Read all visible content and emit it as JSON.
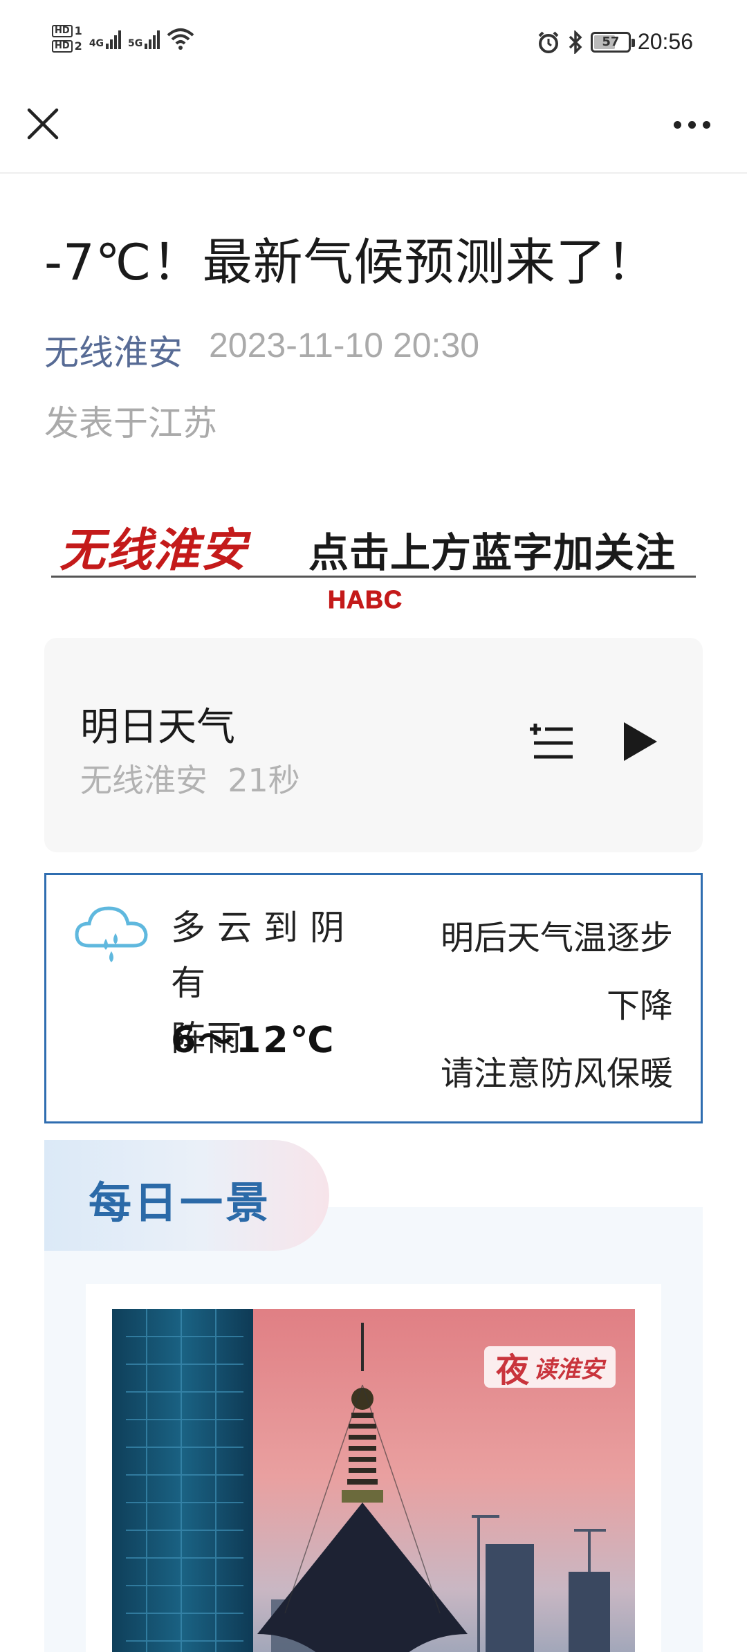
{
  "status_bar": {
    "hd1": "HD",
    "hd1_sub": "1",
    "hd2": "HD",
    "hd2_sub": "2",
    "net1": "4G",
    "net2": "5G",
    "battery": "57",
    "time": "20:56",
    "icons": [
      "alarm-icon",
      "bluetooth-icon",
      "wifi-icon",
      "signal-icon",
      "battery-icon"
    ]
  },
  "nav": {
    "close_icon": "close-icon",
    "more_icon": "more-icon"
  },
  "article": {
    "title": "-7℃！最新气候预测来了！",
    "account": "无线淮安",
    "date": "2023-11-10 20:30",
    "location": "发表于江苏"
  },
  "banner": {
    "brand": "无线淮安",
    "tagline": "点击上方蓝字加关注",
    "logo": "HABC"
  },
  "audio": {
    "title": "明日天气",
    "source": "无线淮安",
    "duration": "21秒"
  },
  "weather": {
    "desc_line1": "多云到阴有",
    "desc_line2": "阵雨",
    "temp": "6～12℃",
    "note_line1": "明后天气温逐步",
    "note_line2": "下降",
    "note_line3": "请注意防风保暖",
    "icon_color": "#5fb8de"
  },
  "scene": {
    "title": "每日一景",
    "watermark_big": "夜",
    "watermark_small": "读淮安"
  },
  "colors": {
    "link": "#576b95",
    "banner_red": "#c41a1a",
    "weather_border": "#2f6db0",
    "scene_title": "#2b6aa8"
  }
}
